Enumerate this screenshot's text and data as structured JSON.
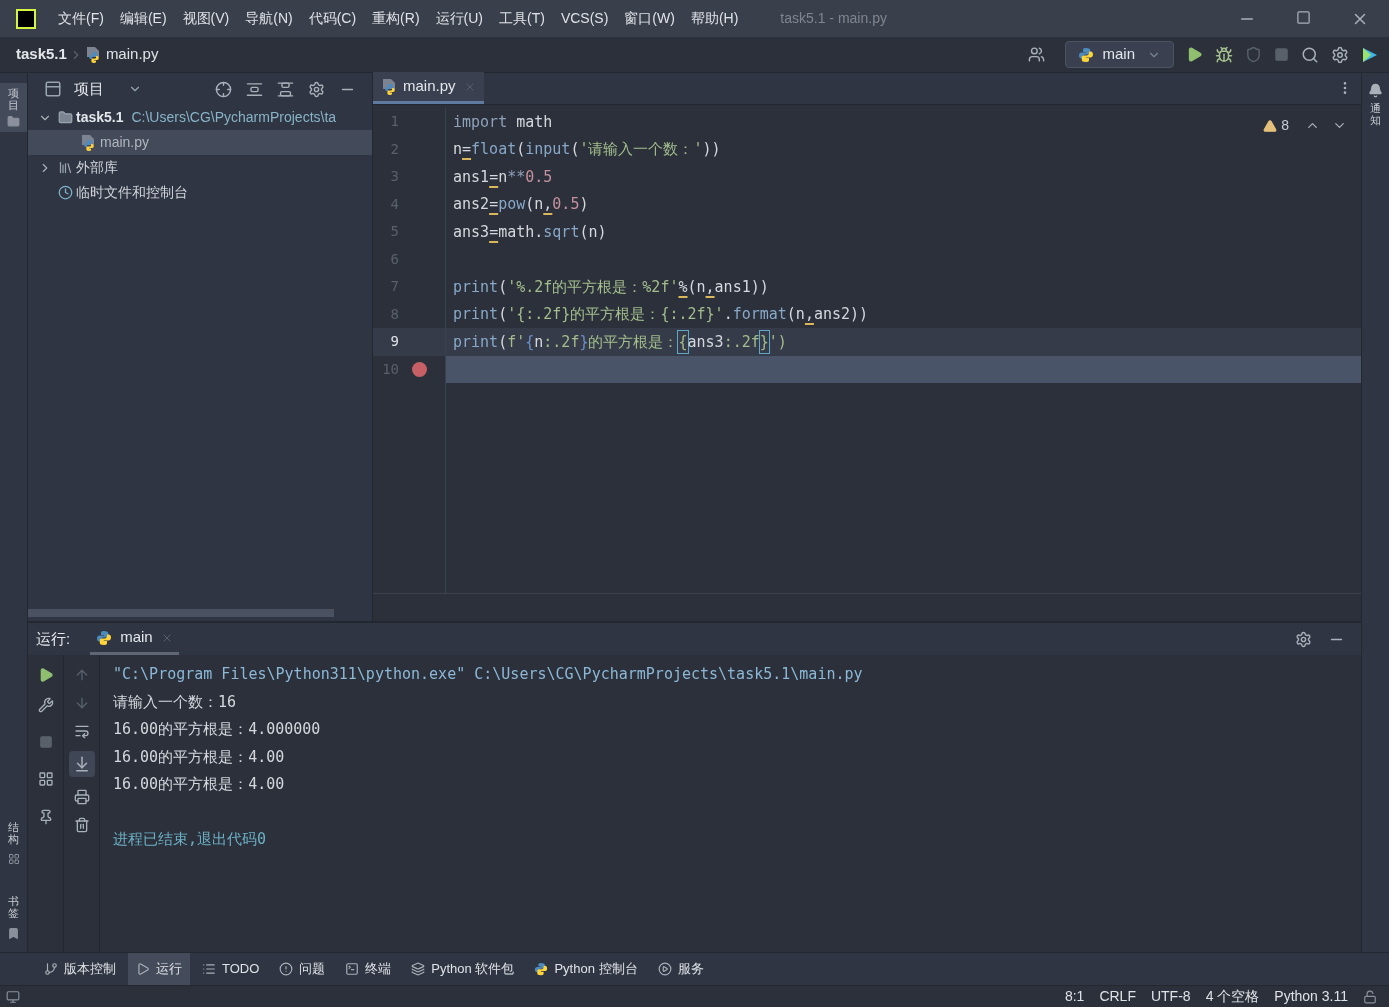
{
  "window": {
    "title": "task5.1 - main.py"
  },
  "menu": [
    "文件(F)",
    "编辑(E)",
    "视图(V)",
    "导航(N)",
    "代码(C)",
    "重构(R)",
    "运行(U)",
    "工具(T)",
    "VCS(S)",
    "窗口(W)",
    "帮助(H)"
  ],
  "breadcrumb": [
    "task5.1",
    "main.py"
  ],
  "run_config": {
    "label": "main"
  },
  "left_strip": [
    "项目",
    "结构",
    "书签"
  ],
  "right_strip": [
    "通知"
  ],
  "project_panel": {
    "title": "项目",
    "tree": [
      {
        "label": "task5.1",
        "detail": "C:\\Users\\CG\\PycharmProjects\\ta",
        "kind": "folder",
        "expanded": true,
        "selected": false,
        "children": [
          {
            "label": "main.py",
            "kind": "python",
            "selected": true
          }
        ]
      },
      {
        "label": "外部库",
        "kind": "library",
        "expanded": false,
        "selected": false
      },
      {
        "label": "临时文件和控制台",
        "kind": "scratch",
        "selected": false
      }
    ]
  },
  "editor": {
    "tabs": [
      {
        "label": "main.py",
        "selected": true
      }
    ],
    "warnings": "8",
    "lines": [
      {
        "number": "1",
        "tokens": [
          {
            "text": "import",
            "kind": "kw"
          },
          {
            "text": " math",
            "kind": "plain"
          }
        ]
      },
      {
        "number": "2",
        "tokens": [
          {
            "text": "n",
            "kind": "plain"
          },
          {
            "text": "=",
            "kind": "op"
          },
          {
            "text": "float",
            "kind": "func"
          },
          {
            "text": "(",
            "kind": "plain"
          },
          {
            "text": "input",
            "kind": "func"
          },
          {
            "text": "(",
            "kind": "plain"
          },
          {
            "text": "'请输入一个数：'",
            "kind": "str"
          },
          {
            "text": "))",
            "kind": "plain"
          }
        ]
      },
      {
        "number": "3",
        "tokens": [
          {
            "text": "ans1",
            "kind": "plain"
          },
          {
            "text": "=",
            "kind": "op"
          },
          {
            "text": "n",
            "kind": "plain"
          },
          {
            "text": "**",
            "kind": "kw"
          },
          {
            "text": "0.5",
            "kind": "num"
          }
        ]
      },
      {
        "number": "4",
        "tokens": [
          {
            "text": "ans2",
            "kind": "plain"
          },
          {
            "text": "=",
            "kind": "op"
          },
          {
            "text": "pow",
            "kind": "func"
          },
          {
            "text": "(n",
            "kind": "plain"
          },
          {
            "text": ",",
            "kind": "op"
          },
          {
            "text": "0.5",
            "kind": "num"
          },
          {
            "text": ")",
            "kind": "plain"
          }
        ]
      },
      {
        "number": "5",
        "tokens": [
          {
            "text": "ans3",
            "kind": "plain"
          },
          {
            "text": "=",
            "kind": "op"
          },
          {
            "text": "math.",
            "kind": "plain"
          },
          {
            "text": "sqrt",
            "kind": "func"
          },
          {
            "text": "(n)",
            "kind": "plain"
          }
        ]
      },
      {
        "number": "6"
      },
      {
        "number": "7",
        "tokens": [
          {
            "text": "print",
            "kind": "func"
          },
          {
            "text": "(",
            "kind": "plain"
          },
          {
            "text": "'%.2f的平方根是：%2f'",
            "kind": "str"
          },
          {
            "text": "%",
            "kind": "op"
          },
          {
            "text": "(n",
            "kind": "plain"
          },
          {
            "text": ",",
            "kind": "op"
          },
          {
            "text": "ans1))",
            "kind": "plain"
          }
        ]
      },
      {
        "number": "8",
        "tokens": [
          {
            "text": "print",
            "kind": "func"
          },
          {
            "text": "(",
            "kind": "plain"
          },
          {
            "text": "'{:.2f}的平方根是：{:.2f}'",
            "kind": "str"
          },
          {
            "text": ".",
            "kind": "plain"
          },
          {
            "text": "format",
            "kind": "func"
          },
          {
            "text": "(n",
            "kind": "plain"
          },
          {
            "text": ",",
            "kind": "op"
          },
          {
            "text": "ans2))",
            "kind": "plain"
          }
        ]
      },
      {
        "number": "9",
        "current": true,
        "tokens": [
          {
            "text": "print",
            "kind": "func"
          },
          {
            "text": "(",
            "kind": "plain"
          },
          {
            "text": "f'",
            "kind": "str"
          },
          {
            "text": "{",
            "kind": "brace"
          },
          {
            "text": "n",
            "kind": "plain"
          },
          {
            "text": ":.2f",
            "kind": "str"
          },
          {
            "text": "}",
            "kind": "brace"
          },
          {
            "text": "的平方根是：",
            "kind": "str"
          },
          {
            "text": "{",
            "kind": "match"
          },
          {
            "text": "ans3",
            "kind": "plain"
          },
          {
            "text": ":.2f",
            "kind": "str"
          },
          {
            "text": "}",
            "kind": "match"
          },
          {
            "text": "')",
            "kind": "str"
          }
        ]
      },
      {
        "number": "10",
        "breakpoint": true,
        "highlighted": true
      }
    ]
  },
  "run_panel": {
    "label": "运行:",
    "tabs": [
      {
        "label": "main",
        "selected": true
      }
    ],
    "output": [
      {
        "text": "\"C:\\Program Files\\Python311\\python.exe\" C:\\Users\\CG\\PycharmProjects\\task5.1\\main.py",
        "kind": "command"
      },
      {
        "text": "请输入一个数：16",
        "kind": "normal"
      },
      {
        "text": "16.00的平方根是：4.000000",
        "kind": "normal"
      },
      {
        "text": "16.00的平方根是：4.00",
        "kind": "normal"
      },
      {
        "text": "16.00的平方根是：4.00",
        "kind": "normal"
      },
      {
        "text": "进程已结束,退出代码0",
        "kind": "exit"
      }
    ]
  },
  "tool_tabs": [
    {
      "label": "版本控制",
      "kind": "branch",
      "selected": false
    },
    {
      "label": "运行",
      "kind": "play",
      "selected": true
    },
    {
      "label": "TODO",
      "kind": "list",
      "selected": false
    },
    {
      "label": "问题",
      "kind": "alert",
      "selected": false
    },
    {
      "label": "终端",
      "kind": "terminal",
      "selected": false
    },
    {
      "label": "Python 软件包",
      "kind": "layers",
      "selected": false
    },
    {
      "label": "Python 控制台",
      "kind": "python",
      "selected": false
    },
    {
      "label": "服务",
      "kind": "service",
      "selected": false
    }
  ],
  "status_bar": [
    "8:1",
    "CRLF",
    "UTF-8",
    "4 个空格",
    "Python 3.11"
  ]
}
